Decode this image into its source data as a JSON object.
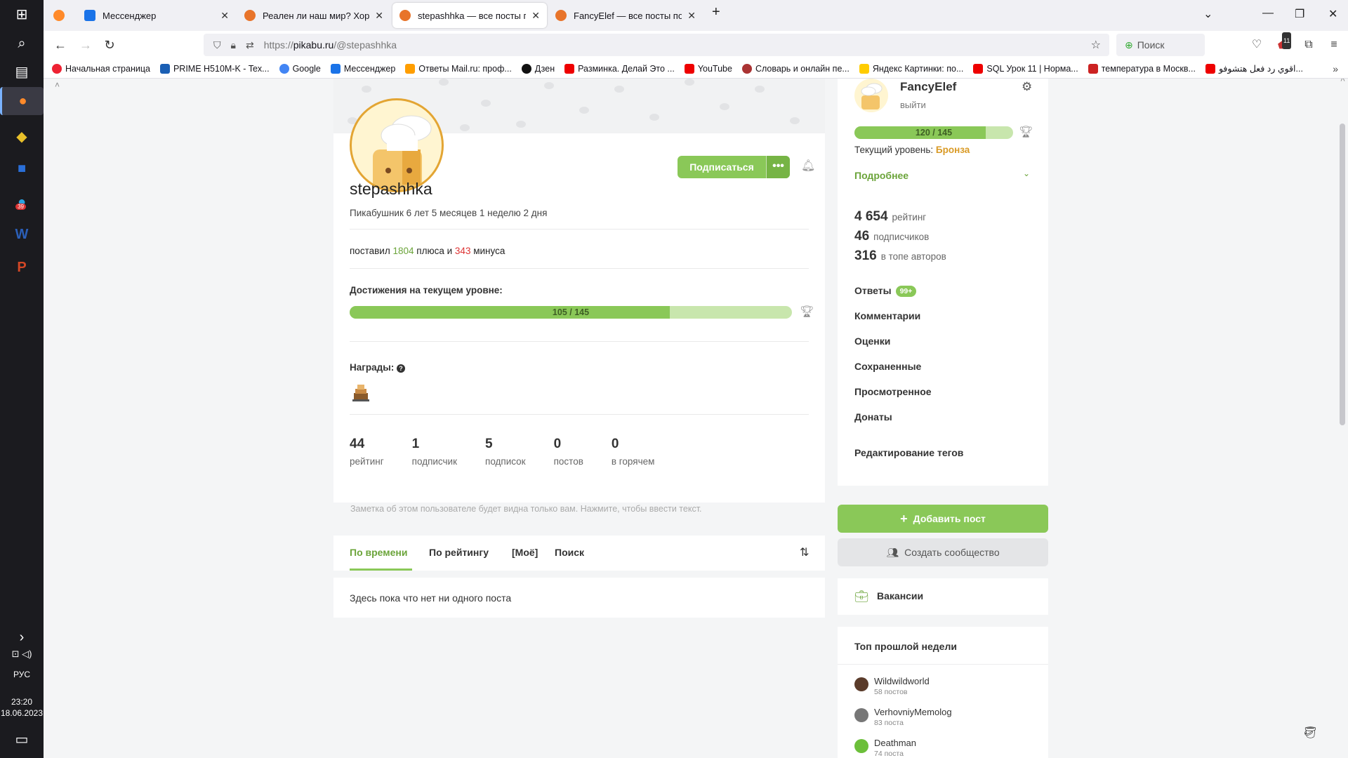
{
  "taskbar": {
    "lang": "РУС",
    "time": "23:20",
    "date": "18.06.2023",
    "telegram_badge": "39"
  },
  "browser": {
    "tabs": [
      {
        "title": "Мессенджер",
        "color": "#1a73e8"
      },
      {
        "title": "Реален ли наш мир? Хороше",
        "color": "#e8742a"
      },
      {
        "title": "stepashhka — все посты польз",
        "color": "#e8742a"
      },
      {
        "title": "FancyElef — все посты пользо",
        "color": "#e8742a"
      }
    ],
    "url_prefix": "https://",
    "url_domain": "pikabu.ru",
    "url_path": "/@stepashhka",
    "search_placeholder": "Поиск",
    "ext_badge": "11"
  },
  "bookmarks": [
    {
      "label": "Начальная страница",
      "color": "#e23"
    },
    {
      "label": "PRIME H510M-K - Tex...",
      "color": "#1a5fb4"
    },
    {
      "label": "Google",
      "color": "#4285f4"
    },
    {
      "label": "Мессенджер",
      "color": "#1a73e8"
    },
    {
      "label": "Ответы Mail.ru: проф...",
      "color": "#ff9e00"
    },
    {
      "label": "Дзен",
      "color": "#111"
    },
    {
      "label": "Разминка. Делай Это ...",
      "color": "#e00"
    },
    {
      "label": "YouTube",
      "color": "#e00"
    },
    {
      "label": "Словарь и онлайн пе...",
      "color": "#a33"
    },
    {
      "label": "Яндекс Картинки: по...",
      "color": "#fc0"
    },
    {
      "label": "SQL Урок 11 | Норма...",
      "color": "#e00"
    },
    {
      "label": "температура в Москв...",
      "color": "#c22"
    },
    {
      "label": "اقوي رد فعل هتشوفو...",
      "color": "#e00"
    }
  ],
  "profile": {
    "username": "stepashhka",
    "since": "Пикабушник 6 лет 5 месяцев 1 неделю 2 дня",
    "subscribe_label": "Подписаться",
    "votes_prefix": "поставил",
    "plus_count": "1804",
    "plus_word": "плюса и",
    "minus_count": "343",
    "minus_word": "минуса",
    "achievements_title": "Достижения на текущем уровне:",
    "achievements_progress": "105 / 145",
    "achievements_fraction": 0.724,
    "awards_title": "Награды:",
    "stats": [
      {
        "value": "44",
        "label": "рейтинг"
      },
      {
        "value": "1",
        "label": "подписчик"
      },
      {
        "value": "5",
        "label": "подписок"
      },
      {
        "value": "0",
        "label": "постов"
      },
      {
        "value": "0",
        "label": "в горячем"
      }
    ],
    "note": "Заметка об этом пользователе будет видна только вам. Нажмите, чтобы ввести текст."
  },
  "post_tabs": [
    "По времени",
    "По рейтингу",
    "[Моё]",
    "Поиск"
  ],
  "empty_text": "Здесь пока что нет ни одного поста",
  "sidebar": {
    "name": "FancyElef",
    "logout": "выйти",
    "progress": "120 / 145",
    "progress_fraction": 0.828,
    "level_prefix": "Текущий уровень:",
    "level": "Бронза",
    "more": "Подробнее",
    "stats": [
      {
        "value": "4 654",
        "label": "рейтинг"
      },
      {
        "value": "46",
        "label": "подписчиков"
      },
      {
        "value": "316",
        "label": "в топе авторов"
      }
    ],
    "menu": [
      "Ответы",
      "Комментарии",
      "Оценки",
      "Сохраненные",
      "Просмотренное",
      "Донаты"
    ],
    "answers_badge": "99+",
    "edit_tags": "Редактирование тегов",
    "add_post": "Добавить пост",
    "create_community": "Создать сообщество",
    "vacancies": "Вакансии",
    "top_title": "Топ прошлой недели",
    "top": [
      {
        "name": "Wildwildworld",
        "count": "58 постов",
        "color": "#5a3b2a"
      },
      {
        "name": "VerhovniyMemolog",
        "count": "83 поста",
        "color": "#777"
      },
      {
        "name": "Deathman",
        "count": "74 поста",
        "color": "#6cbf3a"
      }
    ]
  }
}
